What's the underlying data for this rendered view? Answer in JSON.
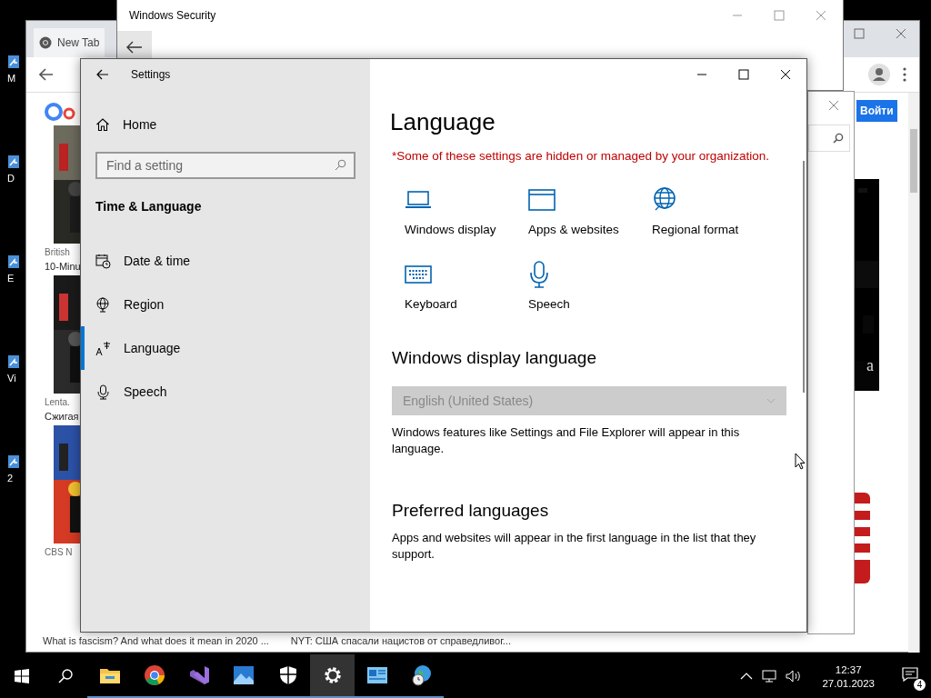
{
  "desktop_icons": [
    {
      "label": "M"
    },
    {
      "label": "D"
    },
    {
      "label": "E"
    },
    {
      "label": "Vi"
    },
    {
      "label": "2"
    }
  ],
  "browser": {
    "tab": "New Tab",
    "sign_in": "Войти",
    "cards": [
      {
        "source": "British",
        "title": "10-Minu"
      },
      {
        "source": "Lenta.",
        "title": "Сжигая"
      },
      {
        "source": "CBS N"
      }
    ],
    "bottom_titles": [
      "What is fascism? And what does it mean in 2020 ...",
      "NYT: США спасали нацистов от справедливог..."
    ],
    "video_letter": "a"
  },
  "security": {
    "title": "Windows Security"
  },
  "settings": {
    "title": "Settings",
    "home": "Home",
    "search": {
      "placeholder": "Find a setting"
    },
    "section": "Time & Language",
    "nav": [
      {
        "kind": "clock",
        "label": "Date & time",
        "selected": false
      },
      {
        "kind": "globe",
        "label": "Region",
        "selected": false
      },
      {
        "kind": "lang",
        "label": "Language",
        "selected": true
      },
      {
        "kind": "mic",
        "label": "Speech",
        "selected": false
      }
    ],
    "heading": "Language",
    "notice": "*Some of these settings are hidden or managed by your organization.",
    "tiles": [
      {
        "kind": "laptop",
        "label": "Windows display"
      },
      {
        "kind": "window",
        "label": "Apps & websites"
      },
      {
        "kind": "globe",
        "label": "Regional format"
      },
      {
        "kind": "keyboard",
        "label": "Keyboard"
      },
      {
        "kind": "mic",
        "label": "Speech"
      }
    ],
    "display_language": {
      "heading": "Windows display language",
      "value": "English (United States)",
      "disabled": true,
      "note": "Windows features like Settings and File Explorer will appear in this language."
    },
    "preferred": {
      "heading": "Preferred languages",
      "note": "Apps and websites will appear in the first language in the list that they support."
    }
  },
  "taskbar": {
    "apps": [
      {
        "kind": "folder",
        "selected": false
      },
      {
        "kind": "chrome",
        "selected": false
      },
      {
        "kind": "vs",
        "selected": false
      },
      {
        "kind": "photos",
        "selected": false
      },
      {
        "kind": "shield",
        "selected": false
      },
      {
        "kind": "gear",
        "selected": true
      },
      {
        "kind": "panel",
        "selected": false
      },
      {
        "kind": "net",
        "selected": false
      }
    ],
    "time": "12:37",
    "date": "27.01.2023",
    "notifications": "4"
  }
}
